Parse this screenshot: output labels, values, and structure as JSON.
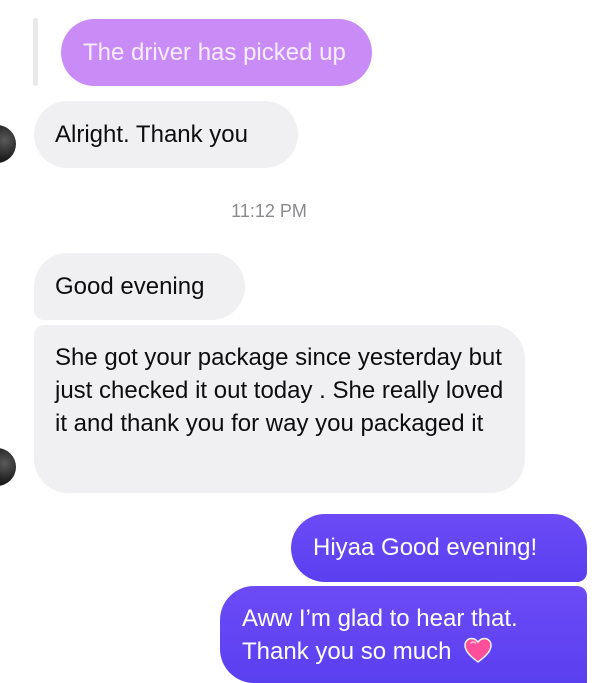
{
  "messages": {
    "reply_preview": "The driver has picked up",
    "alright": "Alright. Thank you",
    "timestamp": "11:12 PM",
    "good_evening": "Good evening",
    "package": "She got your package since yesterday but just checked it out today . She really loved it  and thank you for way you packaged it",
    "hiyaa": "Hiyaa Good evening!",
    "aww_line1": "Aww I’m glad to hear that.",
    "aww_line2": "Thank you so much"
  },
  "icons": {
    "heart": "heart-icon"
  },
  "colors": {
    "outgoing": "#5e42f2",
    "incoming": "#f0f0f2",
    "reply": "#c98cf6",
    "heart": "#ff4f9a"
  }
}
